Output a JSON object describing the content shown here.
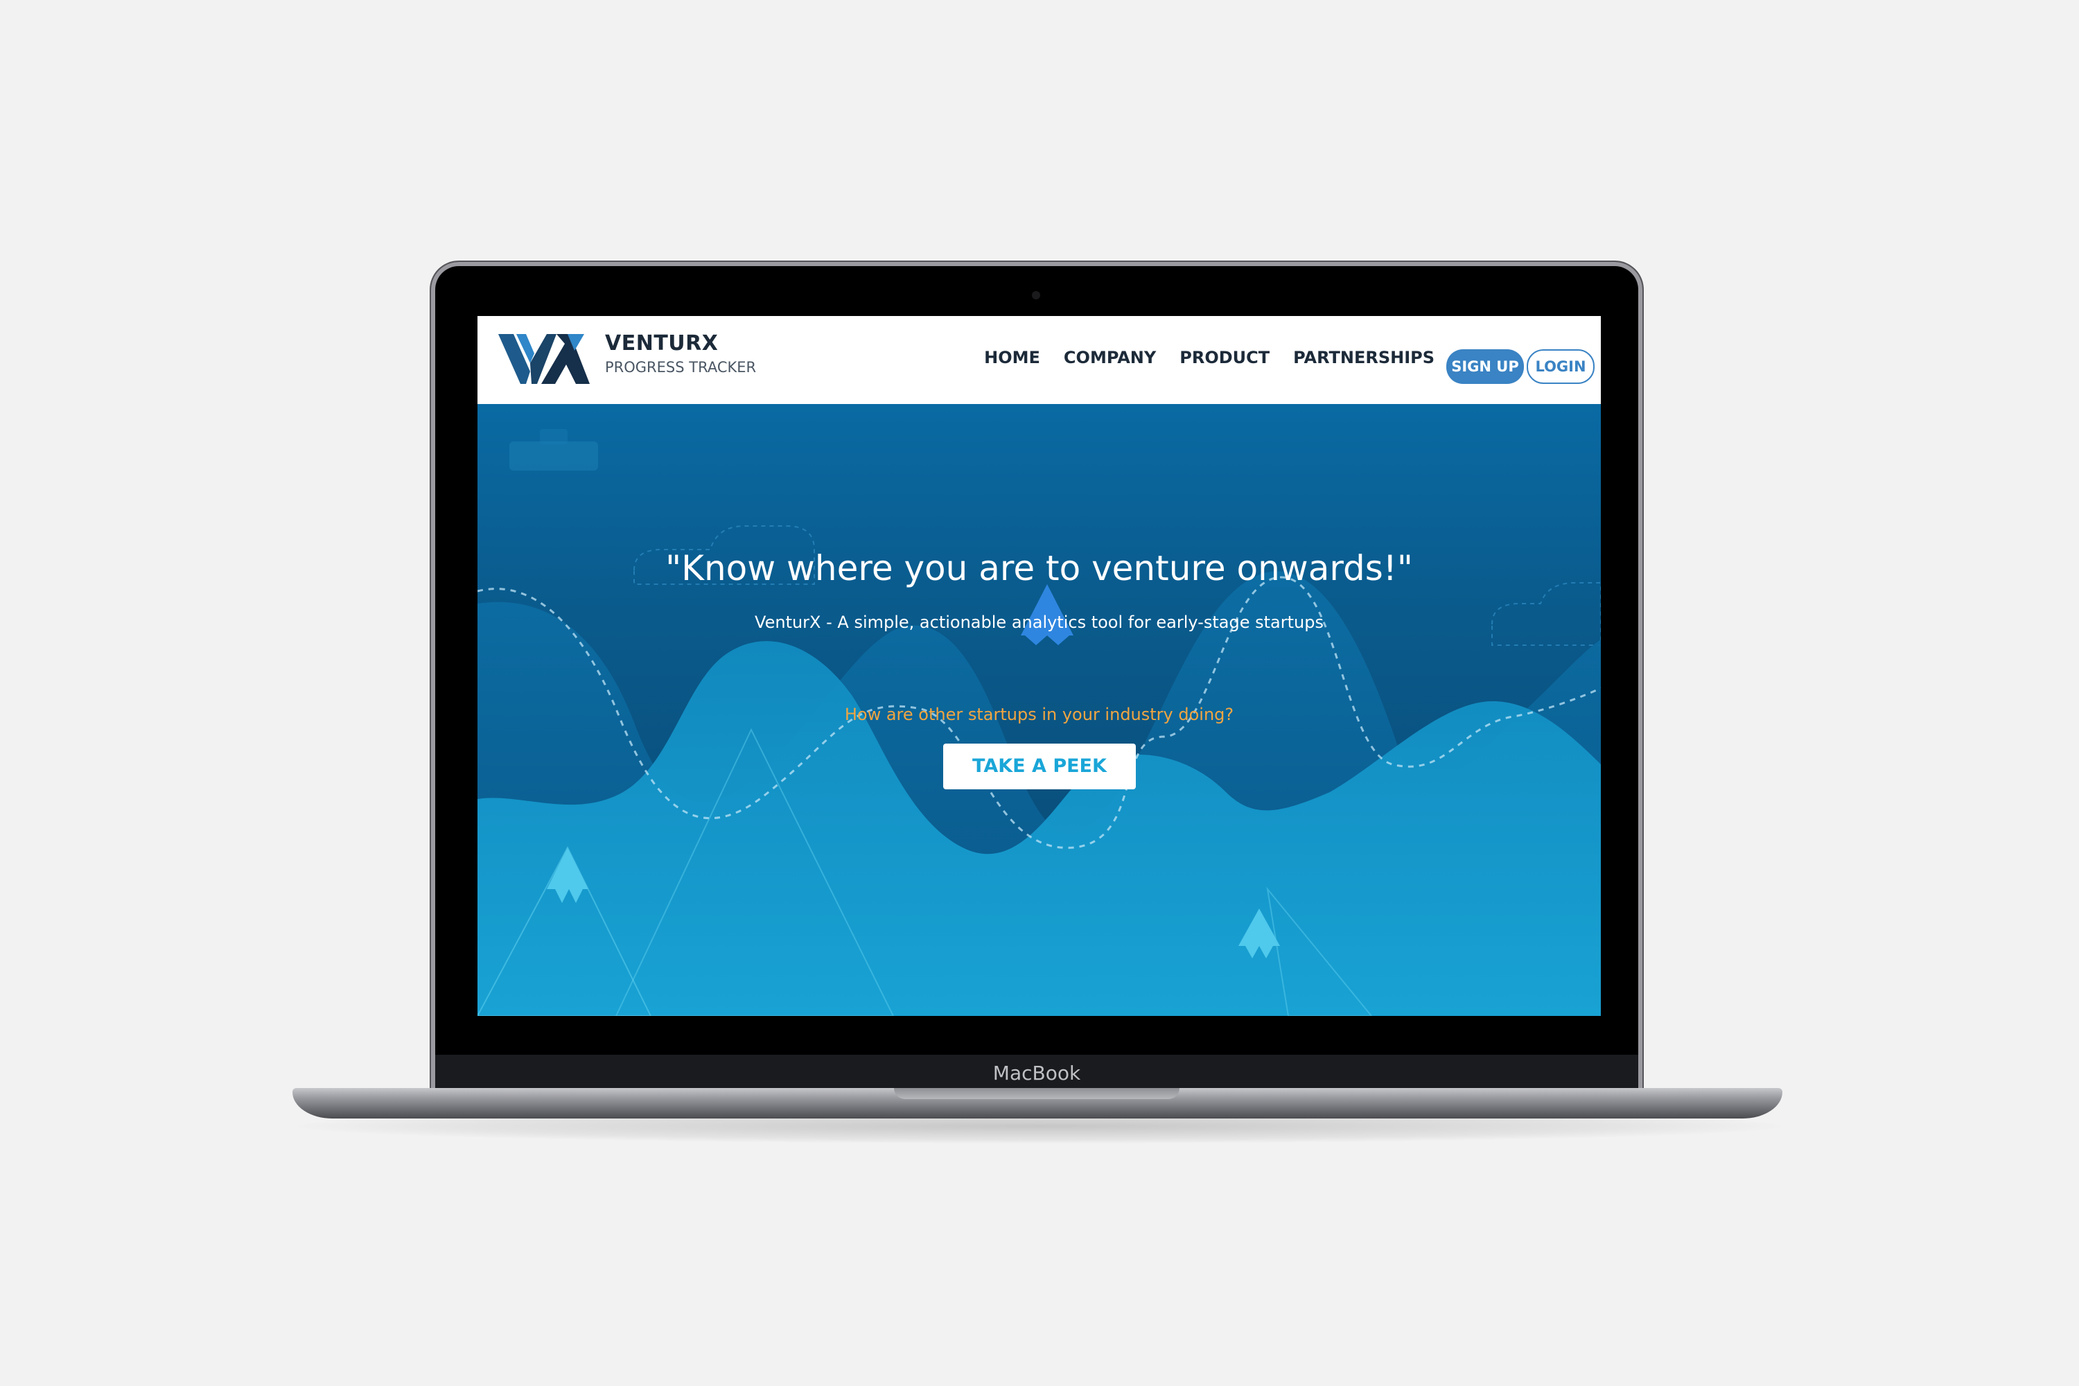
{
  "device": {
    "label": "MacBook"
  },
  "brand": {
    "name": "VENTURX",
    "tagline": "PROGRESS TRACKER",
    "logo_icon": "vx-logo-icon"
  },
  "nav": {
    "links": [
      {
        "label": "HOME"
      },
      {
        "label": "COMPANY"
      },
      {
        "label": "PRODUCT"
      },
      {
        "label": "PARTNERSHIPS"
      }
    ],
    "signup_label": "SIGN UP",
    "login_label": "LOGIN"
  },
  "hero": {
    "headline": "\"Know where you are to venture onwards!\"",
    "subheadline": "VenturX - A simple, actionable analytics tool for early-stage startups",
    "question": "How are other startups in your industry doing?",
    "cta_label": "TAKE A PEEK"
  },
  "colors": {
    "brand_blue": "#3a83c4",
    "hero_dark": "#0a4f7c",
    "hero_light": "#1aa6d8",
    "accent_orange": "#f0a541",
    "nav_text": "#1c2a39"
  }
}
